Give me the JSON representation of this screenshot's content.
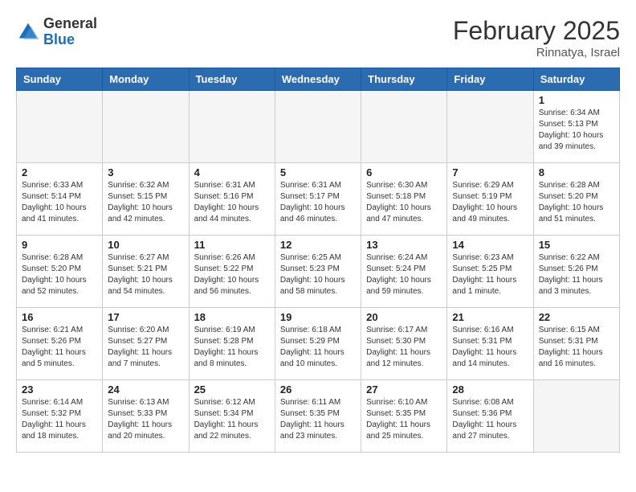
{
  "header": {
    "logo_general": "General",
    "logo_blue": "Blue",
    "month_title": "February 2025",
    "location": "Rinnatya, Israel"
  },
  "weekdays": [
    "Sunday",
    "Monday",
    "Tuesday",
    "Wednesday",
    "Thursday",
    "Friday",
    "Saturday"
  ],
  "weeks": [
    [
      {
        "day": null
      },
      {
        "day": null
      },
      {
        "day": null
      },
      {
        "day": null
      },
      {
        "day": null
      },
      {
        "day": null
      },
      {
        "day": 1,
        "sunrise": "6:34 AM",
        "sunset": "5:13 PM",
        "daylight": "10 hours and 39 minutes."
      }
    ],
    [
      {
        "day": 2,
        "sunrise": "6:33 AM",
        "sunset": "5:14 PM",
        "daylight": "10 hours and 41 minutes."
      },
      {
        "day": 3,
        "sunrise": "6:32 AM",
        "sunset": "5:15 PM",
        "daylight": "10 hours and 42 minutes."
      },
      {
        "day": 4,
        "sunrise": "6:31 AM",
        "sunset": "5:16 PM",
        "daylight": "10 hours and 44 minutes."
      },
      {
        "day": 5,
        "sunrise": "6:31 AM",
        "sunset": "5:17 PM",
        "daylight": "10 hours and 46 minutes."
      },
      {
        "day": 6,
        "sunrise": "6:30 AM",
        "sunset": "5:18 PM",
        "daylight": "10 hours and 47 minutes."
      },
      {
        "day": 7,
        "sunrise": "6:29 AM",
        "sunset": "5:19 PM",
        "daylight": "10 hours and 49 minutes."
      },
      {
        "day": 8,
        "sunrise": "6:28 AM",
        "sunset": "5:20 PM",
        "daylight": "10 hours and 51 minutes."
      }
    ],
    [
      {
        "day": 9,
        "sunrise": "6:28 AM",
        "sunset": "5:20 PM",
        "daylight": "10 hours and 52 minutes."
      },
      {
        "day": 10,
        "sunrise": "6:27 AM",
        "sunset": "5:21 PM",
        "daylight": "10 hours and 54 minutes."
      },
      {
        "day": 11,
        "sunrise": "6:26 AM",
        "sunset": "5:22 PM",
        "daylight": "10 hours and 56 minutes."
      },
      {
        "day": 12,
        "sunrise": "6:25 AM",
        "sunset": "5:23 PM",
        "daylight": "10 hours and 58 minutes."
      },
      {
        "day": 13,
        "sunrise": "6:24 AM",
        "sunset": "5:24 PM",
        "daylight": "10 hours and 59 minutes."
      },
      {
        "day": 14,
        "sunrise": "6:23 AM",
        "sunset": "5:25 PM",
        "daylight": "11 hours and 1 minute."
      },
      {
        "day": 15,
        "sunrise": "6:22 AM",
        "sunset": "5:26 PM",
        "daylight": "11 hours and 3 minutes."
      }
    ],
    [
      {
        "day": 16,
        "sunrise": "6:21 AM",
        "sunset": "5:26 PM",
        "daylight": "11 hours and 5 minutes."
      },
      {
        "day": 17,
        "sunrise": "6:20 AM",
        "sunset": "5:27 PM",
        "daylight": "11 hours and 7 minutes."
      },
      {
        "day": 18,
        "sunrise": "6:19 AM",
        "sunset": "5:28 PM",
        "daylight": "11 hours and 8 minutes."
      },
      {
        "day": 19,
        "sunrise": "6:18 AM",
        "sunset": "5:29 PM",
        "daylight": "11 hours and 10 minutes."
      },
      {
        "day": 20,
        "sunrise": "6:17 AM",
        "sunset": "5:30 PM",
        "daylight": "11 hours and 12 minutes."
      },
      {
        "day": 21,
        "sunrise": "6:16 AM",
        "sunset": "5:31 PM",
        "daylight": "11 hours and 14 minutes."
      },
      {
        "day": 22,
        "sunrise": "6:15 AM",
        "sunset": "5:31 PM",
        "daylight": "11 hours and 16 minutes."
      }
    ],
    [
      {
        "day": 23,
        "sunrise": "6:14 AM",
        "sunset": "5:32 PM",
        "daylight": "11 hours and 18 minutes."
      },
      {
        "day": 24,
        "sunrise": "6:13 AM",
        "sunset": "5:33 PM",
        "daylight": "11 hours and 20 minutes."
      },
      {
        "day": 25,
        "sunrise": "6:12 AM",
        "sunset": "5:34 PM",
        "daylight": "11 hours and 22 minutes."
      },
      {
        "day": 26,
        "sunrise": "6:11 AM",
        "sunset": "5:35 PM",
        "daylight": "11 hours and 23 minutes."
      },
      {
        "day": 27,
        "sunrise": "6:10 AM",
        "sunset": "5:35 PM",
        "daylight": "11 hours and 25 minutes."
      },
      {
        "day": 28,
        "sunrise": "6:08 AM",
        "sunset": "5:36 PM",
        "daylight": "11 hours and 27 minutes."
      },
      {
        "day": null
      }
    ]
  ]
}
